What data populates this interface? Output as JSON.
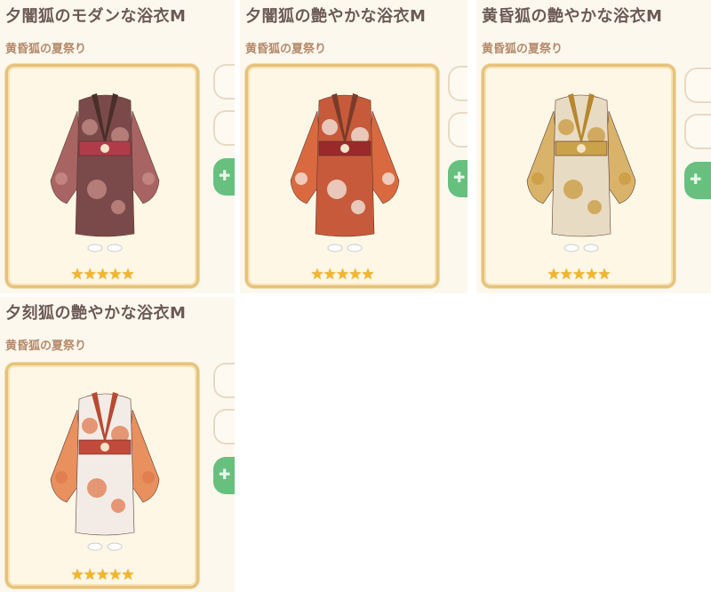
{
  "items": [
    {
      "name": "夕闇狐のモダンな浴衣M",
      "event": "黄昏狐の夏祭り",
      "stars": "★★★★★",
      "palette": {
        "main": "#7a4a4a",
        "accent": "#c98f88",
        "sleeve": "#a86463",
        "obi": "#b23b4a",
        "collar": "#4a2e2a"
      }
    },
    {
      "name": "夕闇狐の艶やかな浴衣M",
      "event": "黄昏狐の夏祭り",
      "stars": "★★★★★",
      "palette": {
        "main": "#c75a3a",
        "accent": "#f4ece4",
        "sleeve": "#d96a3f",
        "obi": "#9a2a2a",
        "collar": "#7a3b2a"
      }
    },
    {
      "name": "黄昏狐の艶やかな浴衣M",
      "event": "黄昏狐の夏祭り",
      "stars": "★★★★★",
      "palette": {
        "main": "#e8dbc4",
        "accent": "#c99a3e",
        "sleeve": "#d9b36a",
        "obi": "#c9a24a",
        "collar": "#b8862e"
      }
    },
    {
      "name": "夕刻狐の艶やかな浴衣M",
      "event": "黄昏狐の夏祭り",
      "stars": "★★★★★",
      "palette": {
        "main": "#f3ece6",
        "accent": "#e07a4e",
        "sleeve": "#e8905e",
        "obi": "#c24a3a",
        "collar": "#b74a32"
      }
    }
  ],
  "action_icon": "gift-icon",
  "action_glyph": "✚"
}
